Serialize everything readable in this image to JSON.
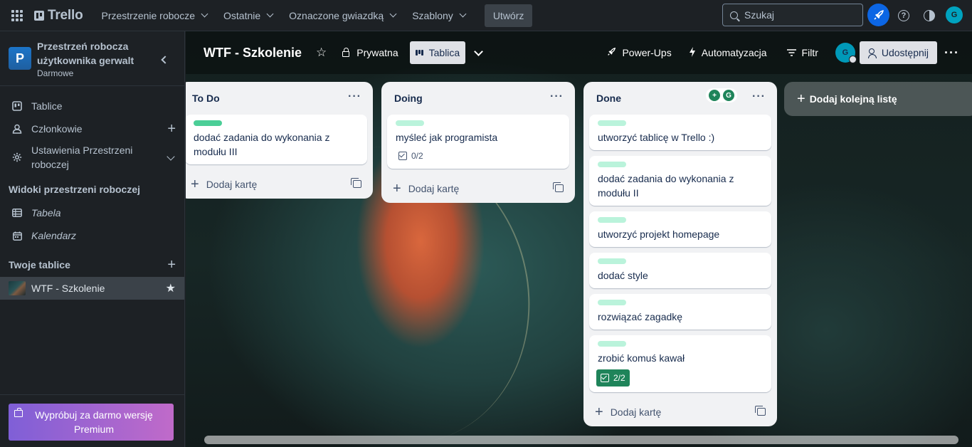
{
  "topnav": {
    "app_name": "Trello",
    "menus": [
      "Przestrzenie robocze",
      "Ostatnie",
      "Oznaczone gwiazdką",
      "Szablony"
    ],
    "create_label": "Utwórz",
    "search_placeholder": "Szukaj",
    "user_initial": "G"
  },
  "sidebar": {
    "workspace_initial": "P",
    "workspace_name": "Przestrzeń robocza użytkownika gerwalt",
    "workspace_plan": "Darmowe",
    "items": [
      {
        "label": "Tablice",
        "icon": "board-icon"
      },
      {
        "label": "Członkowie",
        "icon": "person-icon"
      },
      {
        "label": "Ustawienia Przestrzeni roboczej",
        "icon": "gear-icon"
      }
    ],
    "views_heading": "Widoki przestrzeni roboczej",
    "views": [
      {
        "label": "Tabela",
        "icon": "table-icon"
      },
      {
        "label": "Kalendarz",
        "icon": "calendar-icon"
      }
    ],
    "boards_heading": "Twoje tablice",
    "boards": [
      {
        "label": "WTF - Szkolenie"
      }
    ],
    "premium_label": "Wypróbuj za darmo wersję Premium"
  },
  "board": {
    "title": "WTF - Szkolenie",
    "visibility": "Prywatna",
    "view": "Tablica",
    "powerups": "Power-Ups",
    "automation": "Automatyzacja",
    "filter": "Filtr",
    "member_initial": "G",
    "share": "Udostępnij",
    "add_list": "Dodaj kolejną listę"
  },
  "lists": [
    {
      "title": "To Do",
      "add_card": "Dodaj kartę",
      "cards": [
        {
          "title": "dodać zadania do wykonania z modułu III",
          "label_color": "#4bce97",
          "checklist": ""
        }
      ]
    },
    {
      "title": "Doing",
      "add_card": "Dodaj kartę",
      "cards": [
        {
          "title": "myśleć jak programista",
          "label_color": "#baf3db",
          "checklist": "0/2"
        }
      ]
    },
    {
      "title": "Done",
      "add_card": "Dodaj kartę",
      "cards": [
        {
          "title": "utworzyć tablicę w Trello :)",
          "label_color": "#baf3db",
          "checklist": ""
        },
        {
          "title": "dodać zadania do wykonania z modułu II",
          "label_color": "#baf3db",
          "checklist": ""
        },
        {
          "title": "utworzyć projekt homepage",
          "label_color": "#baf3db",
          "checklist": ""
        },
        {
          "title": "dodać style",
          "label_color": "#baf3db",
          "checklist": ""
        },
        {
          "title": "rozwiązać zagadkę",
          "label_color": "#baf3db",
          "checklist": ""
        },
        {
          "title": "zrobić komuś kawał",
          "label_color": "#baf3db",
          "checklist": "2/2"
        }
      ]
    }
  ],
  "colors": {
    "accent": "#0c66e4",
    "complete_badge": "#1f845a"
  }
}
